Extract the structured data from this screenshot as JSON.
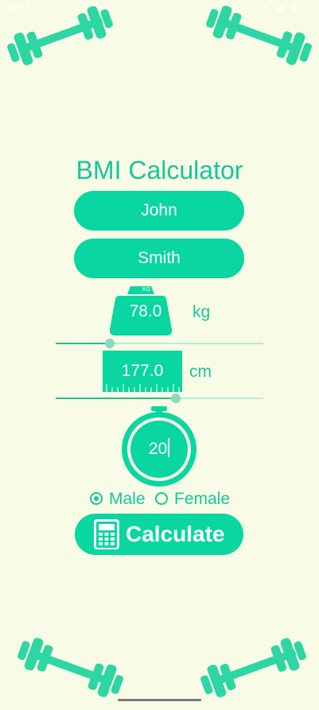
{
  "status_bar": {
    "time": "9:53",
    "icons": "▾ ◢ ▮"
  },
  "app": {
    "title": "BMI Calculator"
  },
  "form": {
    "first_name": "John",
    "last_name": "Smith",
    "weight": {
      "badge": "KG",
      "value": "78.0",
      "unit": "kg",
      "slider_fraction": 0.26
    },
    "height": {
      "value": "177.0",
      "unit": "cm",
      "slider_fraction": 0.58
    },
    "age": {
      "value": "20"
    },
    "gender": {
      "options": [
        "Male",
        "Female"
      ],
      "selected": "Male"
    },
    "calculate_label": "Calculate"
  },
  "colors": {
    "accent": "#09d6a0",
    "background": "#f8fce6",
    "text_accent": "#16c79a"
  },
  "icons": [
    "dumbbell-icon",
    "kettlebell-weight-icon",
    "ruler-icon",
    "stopwatch-icon",
    "calculator-icon"
  ]
}
